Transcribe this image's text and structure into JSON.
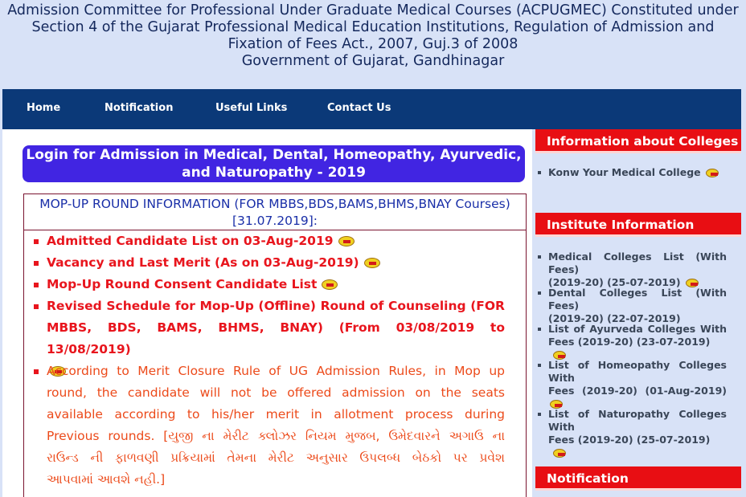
{
  "header": {
    "line1": "Admission Committee for Professional Under Graduate Medical Courses (ACPUGMEC) Constituted under",
    "line2": "Section 4 of the Gujarat Professional Medical Education Institutions, Regulation of Admission and",
    "line3": "Fixation of Fees Act., 2007, Guj.3 of 2008",
    "line4": "Government of Gujarat, Gandhinagar"
  },
  "nav": {
    "home": "Home",
    "notification": "Notification",
    "useful_links": "Useful Links",
    "contact_us": "Contact Us"
  },
  "login": {
    "line1": "Login for Admission in Medical, Dental, Homeopathy, Ayurvedic,",
    "line2": "and Naturopathy - 2019"
  },
  "mop": {
    "title1": "MOP-UP ROUND INFORMATION (FOR MBBS,BDS,BAMS,BHMS,BNAY Courses)",
    "title2": "[31.07.2019]:",
    "items": [
      "Admitted Candidate List on 03-Aug-2019",
      "Vacancy and Last Merit (As on 03-Aug-2019)",
      "Mop-Up Round Consent Candidate List",
      "Revised Schedule for Mop-Up (Offline) Round of Counseling (FOR",
      "MBBS, BDS, BAMS, BHMS, BNAY) (From 03/08/2019 to 13/08/2019)"
    ],
    "rule_lines": [
      "According to Merit Closure Rule of UG Admission Rules, in Mop up",
      "round, the candidate will not be offered admission on the seats",
      "available according to his/her merit in allotment process during",
      "Previous rounds. [યુજી ના મેરીટ ક્લોઝર નિયમ મુજબ, ઉમેદવારને અગાઉ ના",
      "રાઉન્ડ ની ફાળવણી પ્રક્રિયામાં તેમના મેરીટ અનુસાર ઉપલબ્ધ બેઠકો પર પ્રવેશ",
      "આપવામાં આવશે નહી.]"
    ]
  },
  "sidebar": {
    "colleges_head": "Information about Colleges",
    "colleges_item": "Konw Your Medical College",
    "institute_head": "Institute Information",
    "institute_items": [
      [
        "Medical Colleges List (With Fees)",
        "(2019-20) (25-07-2019)"
      ],
      [
        "Dental Colleges List (With Fees)",
        "(2019-20) (22-07-2019)"
      ],
      [
        "List of Ayurveda Colleges With",
        "Fees (2019-20) (23-07-2019)"
      ],
      [
        "List of Homeopathy Colleges With",
        "Fees (2019-20) (01-Aug-2019)"
      ],
      [
        "List of Naturopathy Colleges With",
        "Fees (2019-20) (25-07-2019)"
      ]
    ],
    "notification_head": "Notification"
  },
  "colors": {
    "nav_bg": "#0b3978",
    "login_bg": "#4125e2",
    "link_red": "#e8151d",
    "side_head_red": "#e80e13",
    "page_bg": "#d8e2f7"
  },
  "icons": [
    "new-icon",
    "bullet-square-icon"
  ]
}
